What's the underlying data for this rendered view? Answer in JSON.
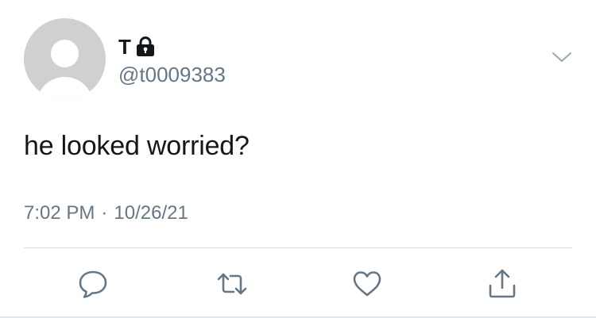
{
  "user": {
    "display_name": "T",
    "handle": "@t0009383",
    "protected_icon": "lock-icon",
    "avatar_icon": "default-avatar-icon"
  },
  "tweet": {
    "text": "he looked worried?",
    "time": "7:02 PM",
    "separator": "·",
    "date": "10/26/21"
  },
  "actions": [
    {
      "name": "reply",
      "icon": "reply-icon"
    },
    {
      "name": "retweet",
      "icon": "retweet-icon"
    },
    {
      "name": "like",
      "icon": "heart-icon"
    },
    {
      "name": "share",
      "icon": "share-icon"
    }
  ],
  "colors": {
    "text_primary": "#14171a",
    "text_secondary": "#657786",
    "icon": "#657786",
    "avatar_bg": "#d0d0d0",
    "divider": "#d9dee2"
  }
}
